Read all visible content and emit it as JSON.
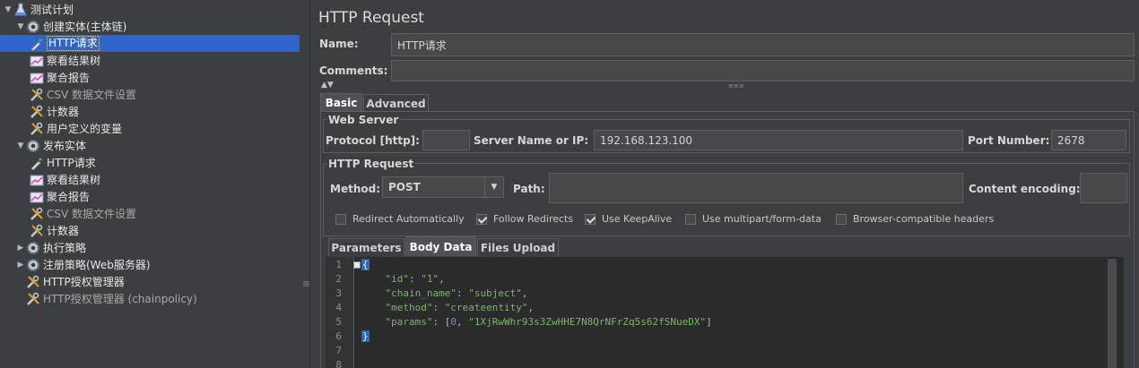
{
  "tree": {
    "items": [
      {
        "label": "测试计划",
        "icon": "flask-icon",
        "expander": "▼",
        "disabled": false
      },
      {
        "label": "创建实体(主体链)",
        "icon": "gear-icon",
        "expander": "▼",
        "disabled": false
      },
      {
        "label": "HTTP请求",
        "icon": "pipette-icon",
        "expander": "",
        "disabled": false,
        "selected": true
      },
      {
        "label": "察看结果树",
        "icon": "chart-icon",
        "expander": "",
        "disabled": false
      },
      {
        "label": "聚合报告",
        "icon": "chart-icon",
        "expander": "",
        "disabled": false
      },
      {
        "label": "CSV 数据文件设置",
        "icon": "wrench-icon",
        "expander": "",
        "disabled": true
      },
      {
        "label": "计数器",
        "icon": "wrench-icon",
        "expander": "",
        "disabled": false
      },
      {
        "label": "用户定义的变量",
        "icon": "wrench-icon",
        "expander": "",
        "disabled": false
      },
      {
        "label": "发布实体",
        "icon": "gear-icon",
        "expander": "▼",
        "disabled": false
      },
      {
        "label": "HTTP请求",
        "icon": "pipette-icon",
        "expander": "",
        "disabled": false
      },
      {
        "label": "察看结果树",
        "icon": "chart-icon",
        "expander": "",
        "disabled": false
      },
      {
        "label": "聚合报告",
        "icon": "chart-icon",
        "expander": "",
        "disabled": false
      },
      {
        "label": "CSV 数据文件设置",
        "icon": "wrench-icon",
        "expander": "",
        "disabled": true
      },
      {
        "label": "计数器",
        "icon": "wrench-icon",
        "expander": "",
        "disabled": false
      },
      {
        "label": "执行策略",
        "icon": "gear-icon",
        "expander": "▶",
        "disabled": false
      },
      {
        "label": "注册策略(Web服务器)",
        "icon": "gear-icon",
        "expander": "▶",
        "disabled": false
      },
      {
        "label": "HTTP授权管理器",
        "icon": "wrench-icon",
        "expander": "",
        "disabled": false
      },
      {
        "label": "HTTP授权管理器 (chainpolicy)",
        "icon": "wrench-icon",
        "expander": "",
        "disabled": true
      }
    ]
  },
  "panel": {
    "title": "HTTP Request",
    "name_label": "Name:",
    "name_value": "HTTP请求",
    "comments_label": "Comments:",
    "comments_value": ""
  },
  "tabs": {
    "basic": "Basic",
    "advanced": "Advanced"
  },
  "web_server": {
    "title": "Web Server",
    "protocol_label": "Protocol [http]:",
    "protocol_value": "",
    "server_label": "Server Name or IP:",
    "server_value": "192.168.123.100",
    "port_label": "Port Number:",
    "port_value": "2678"
  },
  "http_request": {
    "title": "HTTP Request",
    "method_label": "Method:",
    "method_value": "POST",
    "path_label": "Path:",
    "path_value": "",
    "encoding_label": "Content encoding:",
    "encoding_value": ""
  },
  "options": [
    {
      "label": "Redirect Automatically",
      "checked": false
    },
    {
      "label": "Follow Redirects",
      "checked": true
    },
    {
      "label": "Use KeepAlive",
      "checked": true
    },
    {
      "label": "Use multipart/form-data",
      "checked": false
    },
    {
      "label": "Browser-compatible headers",
      "checked": false
    }
  ],
  "subtabs": {
    "parameters": "Parameters",
    "body": "Body Data",
    "files": "Files Upload"
  },
  "editor": {
    "lines": [
      {
        "num": "1",
        "text": "{"
      },
      {
        "num": "2",
        "text": "    \"id\": \"1\","
      },
      {
        "num": "3",
        "text": "    \"chain_name\": \"subject\","
      },
      {
        "num": "4",
        "text": "    \"method\": \"createentity\","
      },
      {
        "num": "5",
        "text": "    \"params\": [0, \"1XjRwWhr93s3ZwHHE7N8QrNFrZq5s62fSNueDX\"]"
      },
      {
        "num": "6",
        "text": "}"
      },
      {
        "num": "7",
        "text": ""
      },
      {
        "num": "8",
        "text": ""
      }
    ]
  },
  "colors": {
    "selection": "#2f65ca",
    "background": "#3c3f41",
    "editor_bg": "#2b2b2b",
    "string": "#77b767",
    "number": "#6897bb"
  }
}
